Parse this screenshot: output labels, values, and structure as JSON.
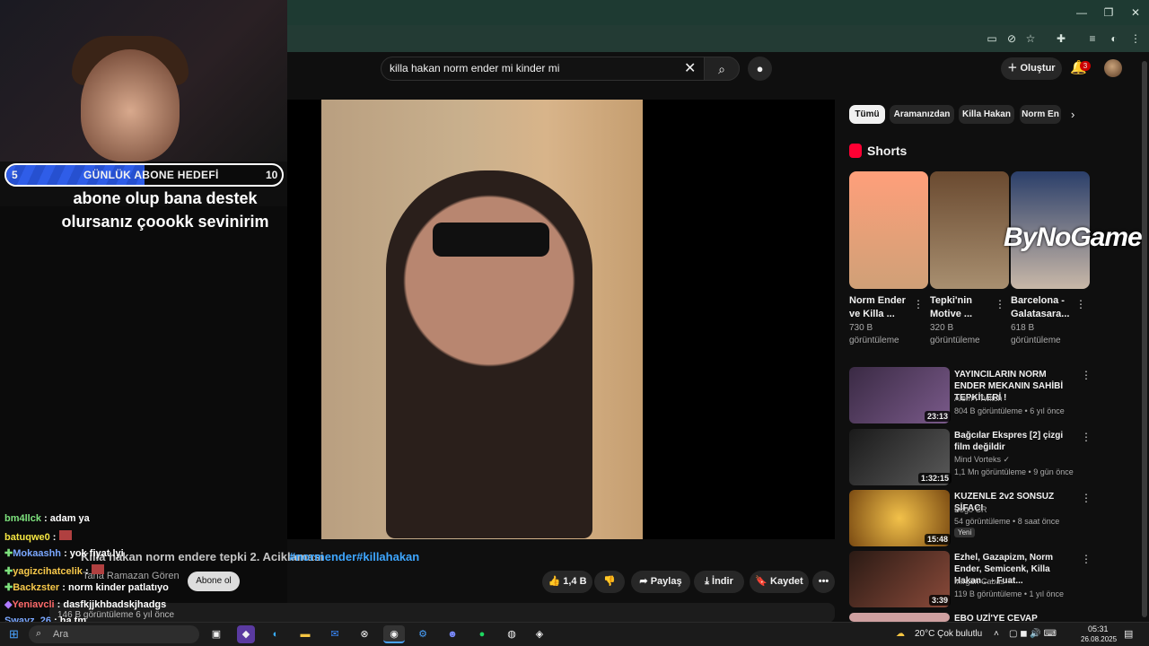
{
  "browser": {
    "window_controls": [
      "—",
      "❐",
      "✕"
    ],
    "toolbar_icons": [
      "screen-icon",
      "eye-off-icon",
      "star-icon",
      "puzzle-icon",
      "media-icon",
      "profile-icon",
      "menu-icon"
    ]
  },
  "youtube": {
    "search": {
      "value": "killa hakan norm ender mi kinder mi",
      "clear": "✕",
      "search_glyph": "⌕",
      "mic_glyph": "🎤"
    },
    "create_label": "Oluştur",
    "notifications_badge": "3"
  },
  "overlay": {
    "goal": {
      "left": "5",
      "title": "GÜNLÜK ABONE HEDEFİ",
      "right": "10",
      "progress": 0.5
    },
    "message": "abone olup bana destek olursanız çoookk sevinirim"
  },
  "video": {
    "title_partial": "Killa hakan norm endere tepki 2. Aciklamasi",
    "hashtags": "#normender#killahakan",
    "channel": "Tana Ramazan Gören",
    "subscribe": "Abone ol",
    "likes": "1,4 B",
    "share": "Paylaş",
    "download": "İndir",
    "save": "Kaydet",
    "more": "•••",
    "desc_meta": "146 B görüntüleme  6 yıl önce"
  },
  "chat": [
    {
      "user": "bm4llck",
      "message": ": adam ya",
      "color": "#7ee37e"
    },
    {
      "user": "batuqwe0",
      "message": ":",
      "color": "#f5e642"
    },
    {
      "user": "Mokaashh",
      "message": ": yok fiyat lyi",
      "color": "#7aa7ff"
    },
    {
      "user": "yagizcihatcelik",
      "message": ":",
      "color": "#f7c84a"
    },
    {
      "user": "Backzster",
      "message": ": norm kinder patlatıyo",
      "color": "#f7c84a"
    },
    {
      "user": "Yeniavcli",
      "message": ": dasfkjjkhbadskjhadgs",
      "color": "#ff6b6b"
    },
    {
      "user": "Swayz_26",
      "message": ": ha tm",
      "color": "#7aa7ff"
    }
  ],
  "sidebar": {
    "chips": [
      "Tümü",
      "Aramanızdan",
      "Killa Hakan",
      "Norm En"
    ],
    "shorts_heading": "Shorts",
    "shorts": [
      {
        "title": "Norm Ender ve Killa ...",
        "views": "730 B görüntüleme",
        "color": "#d9b28a"
      },
      {
        "title": "Tepki'nin Motive ...",
        "views": "320 B görüntüleme",
        "color": "#8a6a4d"
      },
      {
        "title": "Barcelona - Galatasara...",
        "views": "618 B görüntüleme",
        "color": "#556a8a"
      }
    ],
    "related": [
      {
        "title": "YAYINCILARIN NORM ENDER MEKANIN SAHİBİ TEPKİLERİ !",
        "channel": "Alem-i Twitch",
        "meta": "804 B görüntüleme • 6 yıl önce",
        "duration": "23:13",
        "color": "#3a2a44"
      },
      {
        "title": "Bağcılar Ekspres [2] çizgi film değildir",
        "channel": "Mind Vorteks ✓",
        "meta": "1,1 Mn görüntüleme • 9 gün önce",
        "duration": "1:32:15",
        "color": "#2a2a2a"
      },
      {
        "title": "KUZENLE 2v2 SONSUZ ŞİFACI",
        "channel": "Bogo CR",
        "meta": "54 görüntüleme • 8 saat önce",
        "badge": "Yeni",
        "duration": "15:48",
        "color": "#b57a1c"
      },
      {
        "title": "Ezhel, Gazapizm, Norm Ender, Semicenk, Killa Hakan... - Fuat...",
        "channel": "Mirgün Cabas ✓",
        "meta": "119 B görüntüleme • 1 yıl önce",
        "duration": "3:39",
        "color": "#4a2a22"
      },
      {
        "title": "EBO UZİ'YE CEVAP VERİYOR |",
        "channel": "",
        "meta": "",
        "duration": "",
        "color": "#cfa0a0"
      }
    ]
  },
  "watermark": "ByNoGame",
  "taskbar": {
    "search_placeholder": "Ara",
    "weather": "20°C  Çok bulutlu",
    "time": "05:31",
    "date": "26.08.2025"
  }
}
